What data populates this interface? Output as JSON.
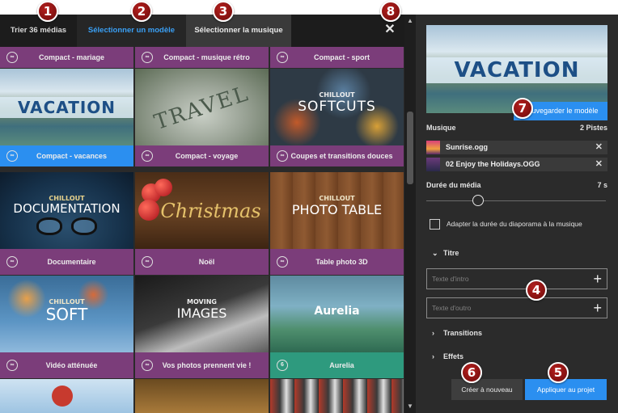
{
  "tabs": [
    {
      "label": "Trier 36 médias",
      "state": "normal"
    },
    {
      "label": "Sélectionner un modèle",
      "state": "active"
    },
    {
      "label": "Sélectionner la musique",
      "state": "current"
    }
  ],
  "close_icon": "close-icon",
  "templates": [
    {
      "label": "Compact - mariage",
      "icon": "infinity-icon"
    },
    {
      "label": "Compact - musique rétro",
      "icon": "infinity-icon"
    },
    {
      "label": "Compact - sport",
      "icon": "infinity-icon"
    },
    {
      "label": "Compact - vacances",
      "icon": "infinity-icon",
      "selected": true,
      "thumb_text": "VACATION"
    },
    {
      "label": "Compact - voyage",
      "icon": "infinity-icon",
      "thumb_text": "TRAVEL"
    },
    {
      "label": "Coupes et transitions douces",
      "icon": "infinity-icon",
      "thumb_top": "CHILLOUT",
      "thumb_text": "SOFTCUTS"
    },
    {
      "label": "Documentaire",
      "icon": "infinity-icon",
      "thumb_top": "CHILLOUT",
      "thumb_text": "DOCUMENTATION"
    },
    {
      "label": "Noël",
      "icon": "infinity-icon",
      "thumb_text": "Christmas"
    },
    {
      "label": "Table photo 3D",
      "icon": "infinity-icon",
      "thumb_top": "CHILLOUT",
      "thumb_text": "PHOTO TABLE"
    },
    {
      "label": "Vidéo atténuée",
      "icon": "infinity-icon",
      "thumb_top": "CHILLOUT",
      "thumb_text": "SOFT"
    },
    {
      "label": "Vos photos prennent vie !",
      "icon": "infinity-icon",
      "thumb_top": "MOVING",
      "thumb_text": "IMAGES"
    },
    {
      "label": "Aurelia",
      "icon": "number-icon",
      "icon_text": "6",
      "thumb_text": "Aurelia"
    }
  ],
  "right": {
    "preview_text": "VACATION",
    "save_label": "Sauvegarder le modèle",
    "music_label": "Musique",
    "music_count": "2 Pistes",
    "tracks": [
      {
        "name": "Sunrise.ogg"
      },
      {
        "name": "02 Enjoy the Holidays.OGG"
      }
    ],
    "duration_label": "Durée du média",
    "duration_value": "7 s",
    "duration_fraction": 0.29,
    "adapt_label": "Adapter la durée du diaporama à la musique",
    "adapt_checked": false,
    "title_section": "Titre",
    "intro_placeholder": "Texte d'intro",
    "outro_placeholder": "Texte d'outro",
    "transitions_section": "Transitions",
    "effects_section": "Effets",
    "new_label": "Créer à nouveau",
    "apply_label": "Appliquer au projet"
  },
  "badges": [
    "1",
    "2",
    "3",
    "4",
    "5",
    "6",
    "7",
    "8"
  ],
  "colors": {
    "accent": "#2b8ff0",
    "template_bar": "#7b3d7a",
    "aurelia_bar": "#2e9a7e",
    "badge": "#a4161a"
  }
}
